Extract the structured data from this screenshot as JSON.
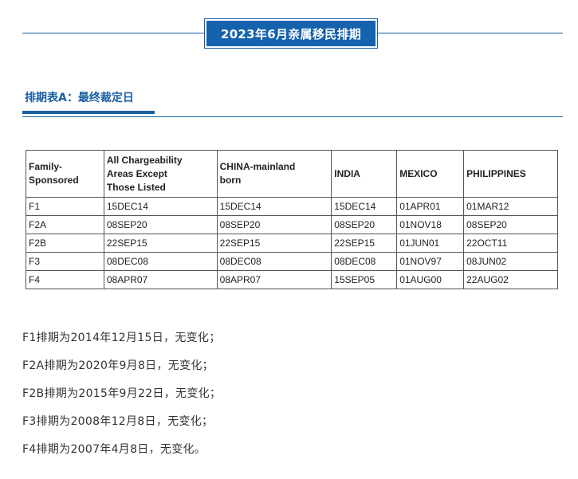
{
  "header": {
    "title": "2023年6月亲属移民排期"
  },
  "section": {
    "title": "排期表A：最终裁定日"
  },
  "table": {
    "headers": [
      "Family-\nSponsored",
      "All Chargeability\nAreas Except\nThose Listed",
      "CHINA-mainland\nborn",
      "INDIA",
      "MEXICO",
      "PHILIPPINES"
    ],
    "rows": [
      [
        "F1",
        "15DEC14",
        "15DEC14",
        "15DEC14",
        "01APR01",
        "01MAR12"
      ],
      [
        "F2A",
        "08SEP20",
        "08SEP20",
        "08SEP20",
        "01NOV18",
        "08SEP20"
      ],
      [
        "F2B",
        "22SEP15",
        "22SEP15",
        "22SEP15",
        "01JUN01",
        "22OCT11"
      ],
      [
        "F3",
        "08DEC08",
        "08DEC08",
        "08DEC08",
        "01NOV97",
        "08JUN02"
      ],
      [
        "F4",
        "08APR07",
        "08APR07",
        "15SEP05",
        "01AUG00",
        "22AUG02"
      ]
    ]
  },
  "notes": [
    "F1排期为2014年12月15日，无变化；",
    "F2A排期为2020年9月8日，无变化；",
    "F2B排期为2015年9月22日，无变化；",
    "F3排期为2008年12月8日，无变化；",
    "F4排期为2007年4月8日，无变化。"
  ],
  "colors": {
    "accent": "#1562ad",
    "text": "#333333",
    "border": "#555555"
  }
}
